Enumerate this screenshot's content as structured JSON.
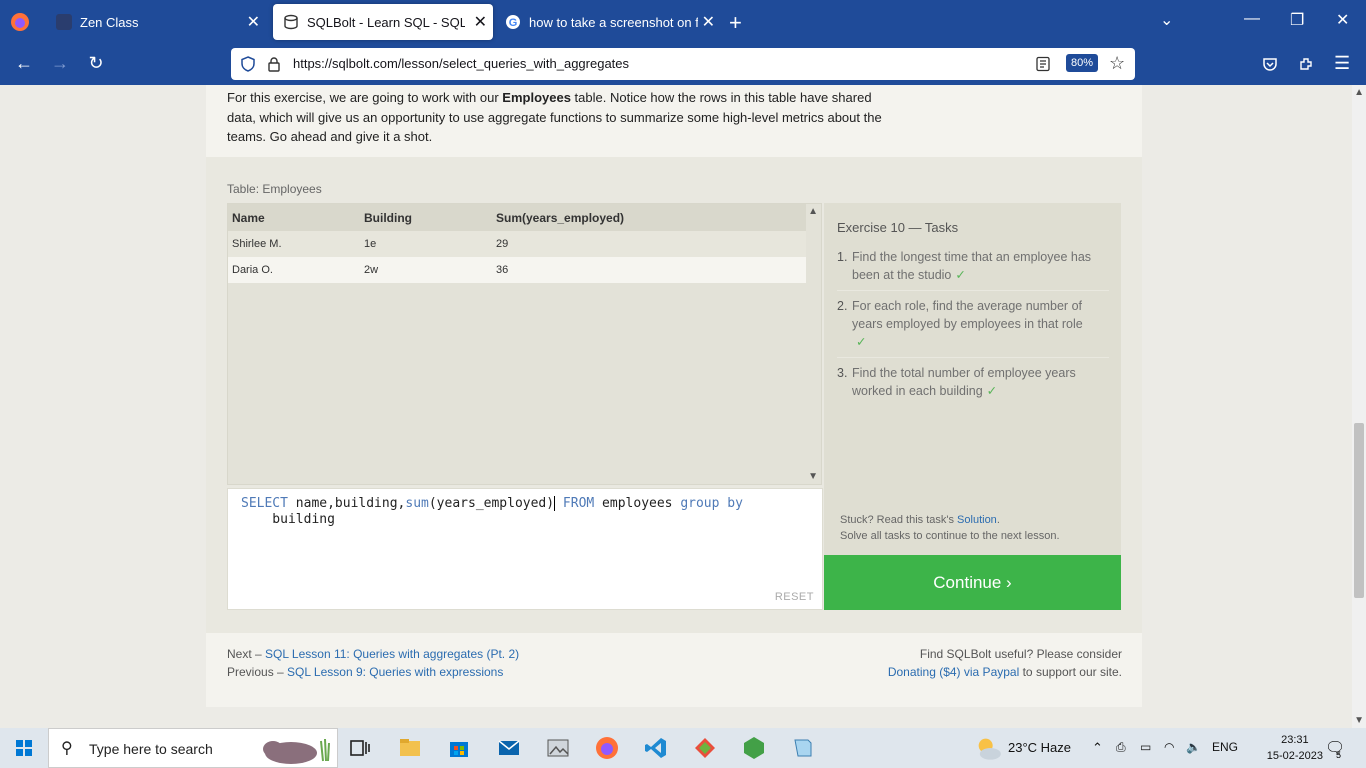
{
  "browser": {
    "tabs": [
      {
        "title": "Zen Class",
        "active": false
      },
      {
        "title": "SQLBolt - Learn SQL - SQL Lesso",
        "active": true
      },
      {
        "title": "how to take a screenshot on fire",
        "active": false
      }
    ],
    "url": "https://sqlbolt.com/lesson/select_queries_with_aggregates",
    "zoom": "80%"
  },
  "page": {
    "intro_before": "For this exercise, we are going to work with our ",
    "intro_bold": "Employees",
    "intro_after": " table. Notice how the rows in this table have shared data, which will give us an opportunity to use aggregate functions to summarize some high-level metrics about the teams. Go ahead and give it a shot.",
    "table_caption": "Table: Employees",
    "result": {
      "columns": [
        "Name",
        "Building",
        "Sum(years_employed)"
      ],
      "rows": [
        [
          "Shirlee M.",
          "1e",
          "29"
        ],
        [
          "Daria O.",
          "2w",
          "36"
        ]
      ]
    },
    "query": {
      "kw_select": "SELECT",
      "part1": " name,building,",
      "fn_sum": "sum",
      "part2": "(years_employed)",
      "kw_from": "FROM",
      "part3": " employees ",
      "kw_group": "group by",
      "line2": "    building"
    },
    "reset_label": "RESET",
    "tasks": {
      "title": "Exercise 10 — Tasks",
      "items": [
        {
          "num": "1.",
          "text": "Find the longest time that an employee has been at the studio",
          "check": "✓"
        },
        {
          "num": "2.",
          "text": "For each role, find the average number of years employed by employees in that role",
          "check": "✓"
        },
        {
          "num": "3.",
          "text": "Find the total number of employee years worked in each building",
          "check": "✓"
        }
      ],
      "stuck_prefix": "Stuck? Read this task's ",
      "stuck_link": "Solution",
      "stuck_suffix": ".",
      "solve_all": "Solve all tasks to continue to the next lesson."
    },
    "continue_label": "Continue ›",
    "footer": {
      "next_prefix": "Next – ",
      "next_link": "SQL Lesson 11: Queries with aggregates (Pt. 2)",
      "prev_prefix": "Previous – ",
      "prev_link": "SQL Lesson 9: Queries with expressions",
      "useful": "Find SQLBolt useful? Please consider",
      "donate_link": "Donating ($4) via Paypal",
      "donate_suffix": " to support our site."
    }
  },
  "taskbar": {
    "search_placeholder": "Type here to search",
    "weather": "23°C  Haze",
    "lang": "ENG",
    "time": "23:31",
    "date": "15-02-2023",
    "notif_count": "5"
  }
}
